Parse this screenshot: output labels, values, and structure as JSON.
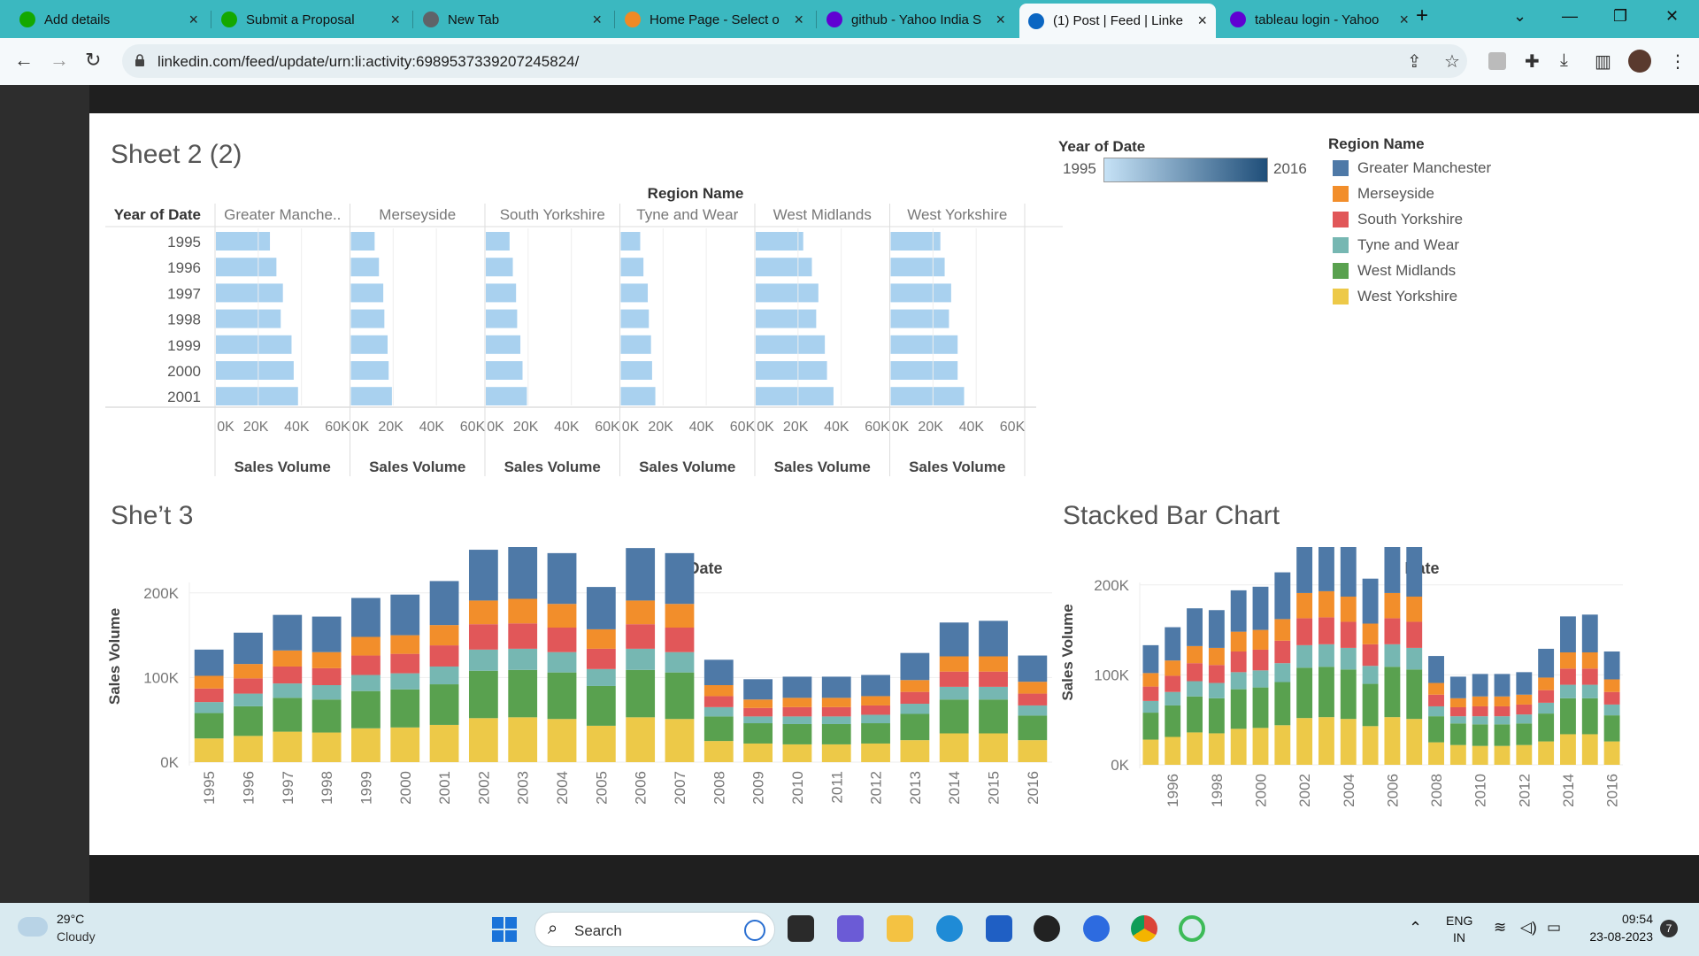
{
  "browser": {
    "tabs": [
      {
        "label": "Add details",
        "favicon": "upwork-icon",
        "color": "#14a800"
      },
      {
        "label": "Submit a Proposal",
        "favicon": "upwork-icon",
        "color": "#14a800"
      },
      {
        "label": "New Tab",
        "favicon": "globe-icon",
        "color": "#5f6368"
      },
      {
        "label": "Home Page - Select o",
        "favicon": "orange-ring-icon",
        "color": "#f08a24"
      },
      {
        "label": "github - Yahoo India S",
        "favicon": "yahoo-icon",
        "color": "#6001d2"
      },
      {
        "label": "(1) Post | Feed | Linke",
        "favicon": "linkedin-icon",
        "color": "#0a66c2"
      },
      {
        "label": "tableau login - Yahoo",
        "favicon": "yahoo-icon",
        "color": "#6001d2"
      }
    ],
    "url": "linkedin.com/feed/update/urn:li:activity:6989537339207245824/"
  },
  "colors": {
    "greater_manchester": "#4e79a7",
    "merseyside": "#f28e2b",
    "south_yorkshire": "#e15759",
    "tyne_and_wear": "#76b7b2",
    "west_midlands": "#59a14f",
    "west_yorkshire": "#edc948",
    "year_gradient_start": "#c6e2f6",
    "year_gradient_end": "#1f4e79",
    "light_bar": "#a9d1ef"
  },
  "dashboard": {
    "sheet2": {
      "title": "Sheet 2 (2)",
      "column_header": "Region Name",
      "row_header": "Year of Date",
      "regions": [
        "Greater Manche..",
        "Merseyside",
        "South Yorkshire",
        "Tyne and Wear",
        "West Midlands",
        "West Yorkshire"
      ],
      "axis_ticks": [
        "0K",
        "20K",
        "40K",
        "60K"
      ],
      "axis_label": "Sales Volume"
    },
    "year_legend": {
      "title": "Year of Date",
      "min": "1995",
      "max": "2016"
    },
    "region_legend": {
      "title": "Region Name",
      "items": [
        "Greater Manchester",
        "Merseyside",
        "South Yorkshire",
        "Tyne and Wear",
        "West Midlands",
        "West Yorkshire"
      ]
    },
    "sheet3": {
      "title": "She’t 3",
      "header": "Date",
      "ylabel": "Sales Volume"
    },
    "stacked": {
      "title": "Stacked Bar Chart",
      "header": "Date",
      "ylabel": "Sales Volume"
    }
  },
  "taskbar": {
    "weather_temp": "29°C",
    "weather_desc": "Cloudy",
    "search_placeholder": "Search",
    "lang_1": "ENG",
    "lang_2": "IN",
    "time": "09:54",
    "date": "23-08-2023",
    "notification_count": "7"
  },
  "chart_data": [
    {
      "type": "bar",
      "title": "Sheet 2 (2)",
      "orientation": "horizontal",
      "facet_by": "Region Name",
      "row_label": "Year of Date",
      "xlabel": "Sales Volume",
      "xlim": [
        0,
        60000
      ],
      "categories": [
        "1995",
        "1996",
        "1997",
        "1998",
        "1999",
        "2000",
        "2001"
      ],
      "series": [
        {
          "name": "Greater Manche..",
          "values": [
            25000,
            28000,
            31000,
            30000,
            35000,
            36000,
            38000
          ]
        },
        {
          "name": "Merseyside",
          "values": [
            11000,
            13000,
            15000,
            15500,
            17000,
            17500,
            19000
          ]
        },
        {
          "name": "South Yorkshire",
          "values": [
            11000,
            12500,
            14000,
            14500,
            16000,
            17000,
            19000
          ]
        },
        {
          "name": "Tyne and Wear",
          "values": [
            9000,
            10500,
            12500,
            13000,
            14000,
            14500,
            16000
          ]
        },
        {
          "name": "West Midlands",
          "values": [
            22000,
            26000,
            29000,
            28000,
            32000,
            33000,
            36000
          ]
        },
        {
          "name": "West Yorkshire",
          "values": [
            23000,
            25000,
            28000,
            27000,
            31000,
            31000,
            34000
          ]
        }
      ]
    },
    {
      "type": "bar",
      "stacked": true,
      "title": "She’t 3",
      "xlabel": "Date",
      "ylabel": "Sales Volume",
      "ylim": [
        0,
        250000
      ],
      "yticks": [
        "0K",
        "100K",
        "200K"
      ],
      "categories": [
        "1995",
        "1996",
        "1997",
        "1998",
        "1999",
        "2000",
        "2001",
        "2002",
        "2003",
        "2004",
        "2005",
        "2006",
        "2007",
        "2008",
        "2009",
        "2010",
        "2011",
        "2012",
        "2013",
        "2014",
        "2015",
        "2016"
      ],
      "series": [
        {
          "name": "West Yorkshire",
          "values": [
            28000,
            31000,
            36000,
            35000,
            40000,
            41000,
            44000,
            52000,
            53000,
            51000,
            43000,
            53000,
            51000,
            25000,
            22000,
            21000,
            21000,
            22000,
            26000,
            34000,
            34000,
            26000
          ]
        },
        {
          "name": "West Midlands",
          "values": [
            30000,
            35000,
            40000,
            39000,
            44000,
            45000,
            48000,
            56000,
            56000,
            55000,
            47000,
            56000,
            55000,
            29000,
            24000,
            24000,
            24000,
            24000,
            31000,
            40000,
            40000,
            29000
          ]
        },
        {
          "name": "Tyne and Wear",
          "values": [
            13000,
            15000,
            17000,
            17000,
            19000,
            19000,
            21000,
            25000,
            25000,
            24000,
            20000,
            25000,
            24000,
            11000,
            8000,
            9000,
            9000,
            10000,
            12000,
            15000,
            15000,
            12000
          ]
        },
        {
          "name": "South Yorkshire",
          "values": [
            16000,
            18000,
            20000,
            20000,
            23000,
            23000,
            25000,
            30000,
            30000,
            29000,
            24000,
            29000,
            29000,
            13000,
            10000,
            11000,
            11000,
            11000,
            14000,
            18000,
            18000,
            14000
          ]
        },
        {
          "name": "Merseyside",
          "values": [
            15000,
            17000,
            19000,
            19000,
            22000,
            22000,
            24000,
            28000,
            29000,
            28000,
            23000,
            28000,
            28000,
            13000,
            10000,
            11000,
            11000,
            11000,
            14000,
            18000,
            18000,
            14000
          ]
        },
        {
          "name": "Greater Manchester",
          "values": [
            31000,
            37000,
            42000,
            42000,
            46000,
            48000,
            52000,
            60000,
            62000,
            60000,
            50000,
            62000,
            60000,
            30000,
            24000,
            25000,
            25000,
            25000,
            32000,
            40000,
            42000,
            31000
          ]
        }
      ]
    },
    {
      "type": "bar",
      "stacked": true,
      "title": "Stacked Bar Chart",
      "xlabel": "Date",
      "ylabel": "Sales Volume",
      "ylim": [
        0,
        250000
      ],
      "yticks": [
        "0K",
        "100K",
        "200K"
      ],
      "categories": [
        "1995",
        "1996",
        "1997",
        "1998",
        "1999",
        "2000",
        "2001",
        "2002",
        "2003",
        "2004",
        "2005",
        "2006",
        "2007",
        "2008",
        "2009",
        "2010",
        "2011",
        "2012",
        "2013",
        "2014",
        "2015",
        "2016"
      ],
      "tick_categories": [
        "1996",
        "1998",
        "2000",
        "2002",
        "2004",
        "2006",
        "2008",
        "2010",
        "2012",
        "2014",
        "2016"
      ],
      "series_ref": "same as Sheet 3"
    }
  ]
}
